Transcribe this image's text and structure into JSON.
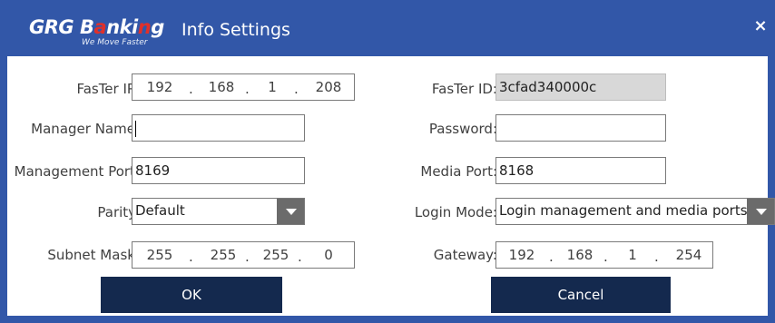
{
  "window": {
    "title": "Info Settings",
    "close_glyph": "×",
    "logo": {
      "text_a": "GRG B",
      "text_accent": "a",
      "text_b": "nki",
      "text_accent2": "n",
      "text_c": "g",
      "tagline": "We Move Faster"
    }
  },
  "colors": {
    "titlebar": "#3257a8",
    "button": "#14294e",
    "logo_accent": "#e0302a"
  },
  "fields": {
    "faster_ip": {
      "label": "FasTer IP:",
      "octets": [
        "192",
        "168",
        "1",
        "208"
      ],
      "separator": "."
    },
    "faster_id": {
      "label": "FasTer ID:",
      "value": "3cfad340000c"
    },
    "manager_name": {
      "label": "Manager Name:",
      "value": ""
    },
    "password": {
      "label": "Password:",
      "value": ""
    },
    "management_port": {
      "label": "Management Port:",
      "value": "8169"
    },
    "media_port": {
      "label": "Media Port:",
      "value": "8168"
    },
    "parity": {
      "label": "Parity:",
      "value": "Default"
    },
    "login_mode": {
      "label": "Login Mode:",
      "value": "Login management and media ports"
    },
    "subnet_mask": {
      "label": "Subnet Mask:",
      "octets": [
        "255",
        "255",
        "255",
        "0"
      ],
      "separator": "."
    },
    "gateway": {
      "label": "Gateway:",
      "octets": [
        "192",
        "168",
        "1",
        "254"
      ],
      "separator": "."
    }
  },
  "buttons": {
    "ok": "OK",
    "cancel": "Cancel"
  },
  "icons": {
    "close": "close-icon",
    "dropdown": "chevron-down-icon"
  }
}
